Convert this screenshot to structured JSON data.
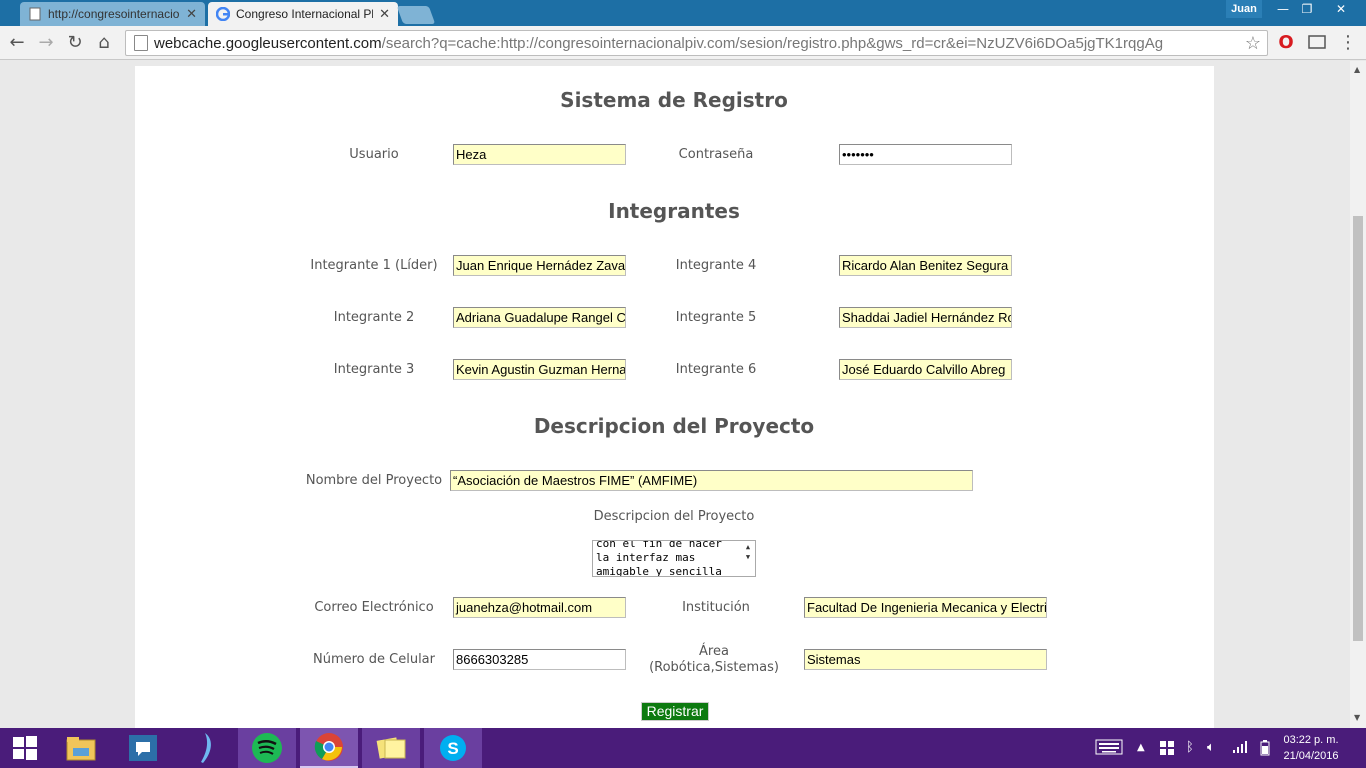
{
  "browser": {
    "tabs": [
      {
        "title": "http://congresointernacio",
        "state": "inactive"
      },
      {
        "title": "Congreso Internacional Pl",
        "state": "active"
      }
    ],
    "profile": "Juan",
    "window_controls": {
      "minimize": "—",
      "restore": "❐",
      "close": "✕"
    },
    "address": {
      "host": "webcache.googleusercontent.com",
      "path": "/search?q=cache:http://congresointernacionalpiv.com/sesion/registro.php&gws_rd=cr&ei=NzUZV6i6DOa5jgTK1rqgAg"
    }
  },
  "form": {
    "title": "Sistema de Registro",
    "usuario": {
      "label": "Usuario",
      "value": "Heza"
    },
    "contrasena": {
      "label": "Contraseña",
      "value": "•••••••"
    },
    "integrantes_title": "Integrantes",
    "integrantes": [
      {
        "label": "Integrante 1 (Líder)",
        "value": "Juan Enrique Hernádez Zavala"
      },
      {
        "label": "Integrante 2",
        "value": "Adriana Guadalupe Rangel C"
      },
      {
        "label": "Integrante 3",
        "value": "Kevin Agustin Guzman Hernandez"
      },
      {
        "label": "Integrante 4",
        "value": "Ricardo Alan Benitez Segura"
      },
      {
        "label": "Integrante 5",
        "value": "Shaddai Jadiel Hernández Ro"
      },
      {
        "label": "Integrante 6",
        "value": "José  Eduardo Calvillo Abreg"
      }
    ],
    "proyecto_title": "Descripcion del Proyecto",
    "nombre_proyecto": {
      "label": "Nombre del Proyecto",
      "value": "“Asociación de Maestros FIME” (AMFIME)"
    },
    "descripcion": {
      "label": "Descripcion del Proyecto",
      "lines": [
        "con el fin de hacer",
        "la interfaz mas",
        "amigable y sencilla"
      ]
    },
    "correo": {
      "label": "Correo Electrónico",
      "value": "juanehza@hotmail.com"
    },
    "institucion": {
      "label": "Institución",
      "value": "Facultad De Ingenieria Mecanica y Electrica"
    },
    "celular": {
      "label": "Número de Celular",
      "value": "8666303285"
    },
    "area": {
      "label_line1": "Área",
      "label_line2": "(Robótica,Sistemas)",
      "value": "Sistemas"
    },
    "submit": "Registrar"
  },
  "taskbar": {
    "clock_time": "03:22 p. m.",
    "clock_date": "21/04/2016",
    "items": [
      "start-icon",
      "file-explorer-icon",
      "chat-icon",
      "feather-app-icon",
      "spotify-icon",
      "chrome-icon",
      "sticky-notes-icon",
      "skype-icon"
    ]
  },
  "colors": {
    "tabstrip": "#1d6fa5",
    "taskbar": "#4a1c7a",
    "field_fill": "#ffffc8",
    "button_green": "#0d7a10",
    "heading": "#555555"
  }
}
